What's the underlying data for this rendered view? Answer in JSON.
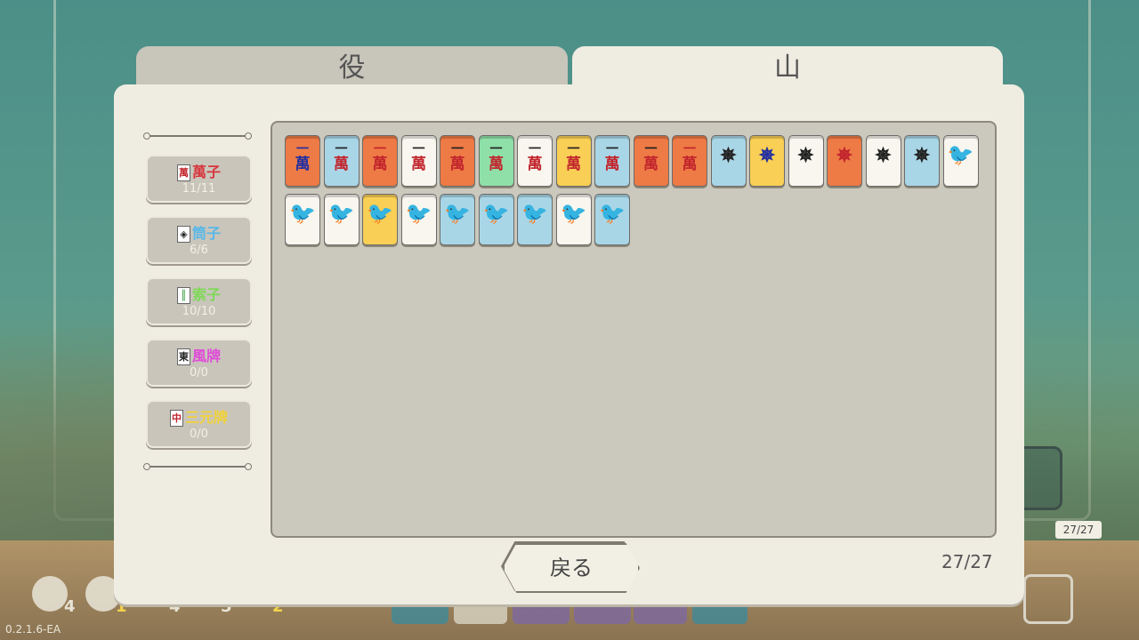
{
  "tabs": {
    "yaku_label": "役",
    "yama_label": "山",
    "active": "yama"
  },
  "categories": [
    {
      "icon_char": "萬",
      "icon_color": "#c2252d",
      "label": "萬子",
      "color": "#d8363d",
      "count": "11/11"
    },
    {
      "icon_char": "◈",
      "icon_color": "#222222",
      "label": "筒子",
      "color": "#56b8e8",
      "count": "6/6"
    },
    {
      "icon_char": "║",
      "icon_color": "#2f9a3a",
      "label": "索子",
      "color": "#7ed957",
      "count": "10/10"
    },
    {
      "icon_char": "東",
      "icon_color": "#222222",
      "label": "風牌",
      "color": "#e04ad8",
      "count": "0/0"
    },
    {
      "icon_char": "中",
      "icon_color": "#c2252d",
      "label": "三元牌",
      "color": "#f0d23a",
      "count": "0/0"
    }
  ],
  "tiles": [
    {
      "suit": "man",
      "top": "一",
      "bottom": "萬",
      "bg": "#ee7a45",
      "top_color": "#2430a0",
      "bottom_color": "#2430a0"
    },
    {
      "suit": "man",
      "top": "一",
      "bottom": "萬",
      "bg": "#a9d6e6",
      "top_color": "#222222",
      "bottom_color": "#c2252d"
    },
    {
      "suit": "man",
      "top": "一",
      "bottom": "萬",
      "bg": "#ee7a45",
      "top_color": "#c2252d",
      "bottom_color": "#c2252d"
    },
    {
      "suit": "man",
      "top": "一",
      "bottom": "萬",
      "bg": "#f8f6ee",
      "top_color": "#222222",
      "bottom_color": "#c2252d"
    },
    {
      "suit": "man",
      "top": "一",
      "bottom": "萬",
      "bg": "#ee7a45",
      "top_color": "#222222",
      "bottom_color": "#c2252d"
    },
    {
      "suit": "man",
      "top": "一",
      "bottom": "萬",
      "bg": "#8fe0a8",
      "top_color": "#222222",
      "bottom_color": "#c2252d"
    },
    {
      "suit": "man",
      "top": "一",
      "bottom": "萬",
      "bg": "#f8f6ee",
      "top_color": "#222222",
      "bottom_color": "#c2252d"
    },
    {
      "suit": "man",
      "top": "一",
      "bottom": "萬",
      "bg": "#f9cf55",
      "top_color": "#222222",
      "bottom_color": "#c2252d"
    },
    {
      "suit": "man",
      "top": "一",
      "bottom": "萬",
      "bg": "#a9d6e6",
      "top_color": "#222222",
      "bottom_color": "#c2252d"
    },
    {
      "suit": "man",
      "top": "一",
      "bottom": "萬",
      "bg": "#ee7a45",
      "top_color": "#222222",
      "bottom_color": "#c2252d"
    },
    {
      "suit": "man",
      "top": "一",
      "bottom": "萬",
      "bg": "#ee7a45",
      "top_color": "#c2252d",
      "bottom_color": "#c2252d"
    },
    {
      "suit": "pin",
      "top": "✵",
      "bottom": "",
      "bg": "#a9d6e6",
      "top_color": "#222222",
      "bottom_color": "#222222"
    },
    {
      "suit": "pin",
      "top": "✵",
      "bottom": "",
      "bg": "#f9cf55",
      "top_color": "#2430a0",
      "bottom_color": "#222222"
    },
    {
      "suit": "pin",
      "top": "✵",
      "bottom": "",
      "bg": "#f8f6ee",
      "top_color": "#222222",
      "bottom_color": "#222222"
    },
    {
      "suit": "pin",
      "top": "✵",
      "bottom": "",
      "bg": "#ee7a45",
      "top_color": "#c2252d",
      "bottom_color": "#222222"
    },
    {
      "suit": "pin",
      "top": "✵",
      "bottom": "",
      "bg": "#f8f6ee",
      "top_color": "#222222",
      "bottom_color": "#222222"
    },
    {
      "suit": "pin",
      "top": "✵",
      "bottom": "",
      "bg": "#a9d6e6",
      "top_color": "#222222",
      "bottom_color": "#222222"
    },
    {
      "suit": "sou",
      "top": "🐦",
      "bottom": "",
      "bg": "#f8f6ee",
      "top_color": "#2f9a3a",
      "bottom_color": "#2f9a3a"
    },
    {
      "suit": "sou",
      "top": "🐦",
      "bottom": "",
      "bg": "#f8f6ee",
      "top_color": "#2f9a3a",
      "bottom_color": "#2f9a3a"
    },
    {
      "suit": "sou",
      "top": "🐦",
      "bottom": "",
      "bg": "#f8f6ee",
      "top_color": "#2f9a3a",
      "bottom_color": "#2f9a3a"
    },
    {
      "suit": "sou",
      "top": "🐦",
      "bottom": "",
      "bg": "#f9cf55",
      "top_color": "#2f9a3a",
      "bottom_color": "#2f9a3a"
    },
    {
      "suit": "sou",
      "top": "🐦",
      "bottom": "",
      "bg": "#f8f6ee",
      "top_color": "#c2257a",
      "bottom_color": "#2f9a3a"
    },
    {
      "suit": "sou",
      "top": "🐦",
      "bottom": "",
      "bg": "#a9d6e6",
      "top_color": "#2f9a3a",
      "bottom_color": "#2f9a3a"
    },
    {
      "suit": "sou",
      "top": "🐦",
      "bottom": "",
      "bg": "#a9d6e6",
      "top_color": "#2f9a3a",
      "bottom_color": "#2f9a3a"
    },
    {
      "suit": "sou",
      "top": "🐦",
      "bottom": "",
      "bg": "#a9d6e6",
      "top_color": "#2f9a3a",
      "bottom_color": "#2f9a3a"
    },
    {
      "suit": "sou",
      "top": "🐦",
      "bottom": "",
      "bg": "#f8f6ee",
      "top_color": "#2f9a3a",
      "bottom_color": "#2f9a3a"
    },
    {
      "suit": "sou",
      "top": "🐦",
      "bottom": "",
      "bg": "#a9d6e6",
      "top_color": "#2f9a3a",
      "bottom_color": "#2f9a3a"
    }
  ],
  "back_button_label": "戻る",
  "total_count": "27/27",
  "side_counter": "27/27",
  "version": "0.2.1.6-EA",
  "bottom_counts": [
    "4",
    "1",
    "4",
    "5",
    "2"
  ]
}
